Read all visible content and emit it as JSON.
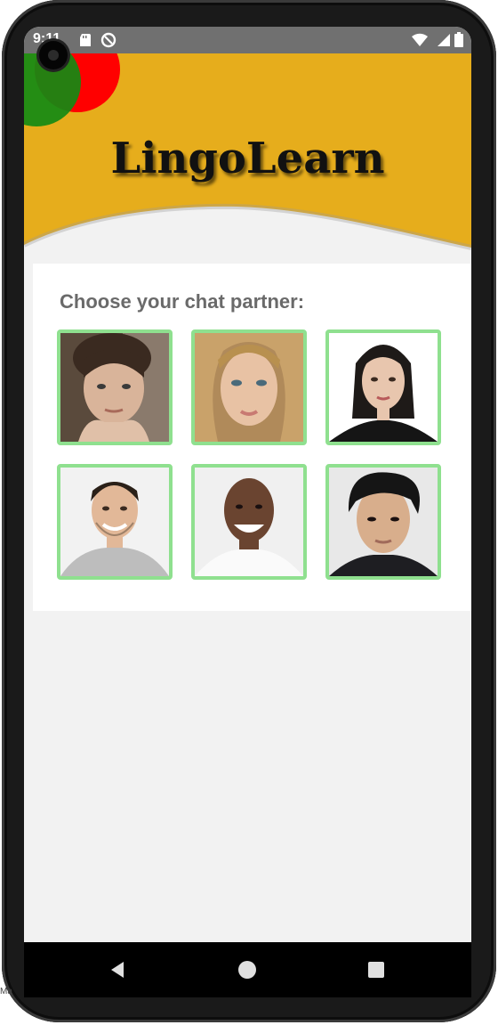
{
  "status_bar": {
    "time": "9:11",
    "icons": [
      "sd-card-icon",
      "data-saver-icon",
      "wifi-icon",
      "battery-icon"
    ]
  },
  "header": {
    "app_title": "LingoLearn",
    "background_color": "#e6ad1c",
    "decoration_colors": [
      "#ff0000",
      "#138a13"
    ]
  },
  "chooser": {
    "title": "Choose your chat partner:",
    "border_color": "#8fe08f",
    "partners": [
      {
        "icon": "woman-avatar-1"
      },
      {
        "icon": "woman-avatar-2"
      },
      {
        "icon": "woman-avatar-3"
      },
      {
        "icon": "man-avatar-1"
      },
      {
        "icon": "man-avatar-2"
      },
      {
        "icon": "man-avatar-3"
      }
    ]
  },
  "nav_bar": {
    "buttons": [
      "back-icon",
      "home-icon",
      "recents-icon"
    ]
  },
  "device_edge_text": "Ma"
}
